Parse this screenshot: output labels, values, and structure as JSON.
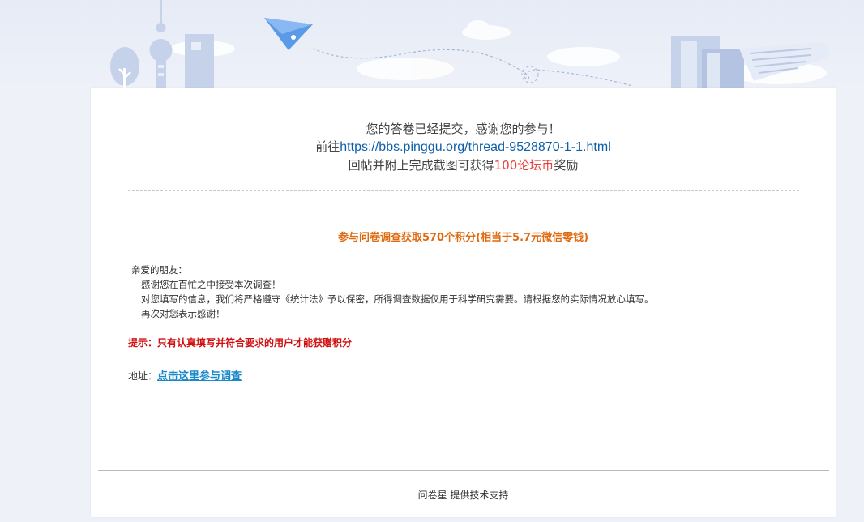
{
  "notice": {
    "line1": "您的答卷已经提交，感谢您的参与！",
    "line2_prefix": "前往",
    "line2_link": "https://bbs.pinggu.org/thread-9528870-1-1.html",
    "line3_prefix": "回帖并附上完成截图可获得",
    "line3_highlight": "100论坛币",
    "line3_suffix": "奖励"
  },
  "survey_title": "参与问卷调查获取570个积分(相当于5.7元微信零钱)",
  "letter": {
    "greeting": "亲爱的朋友：",
    "lines": [
      "感谢您在百忙之中接受本次调查！",
      "对您填写的信息，我们将严格遵守《统计法》予以保密，所得调查数据仅用于科学研究需要。请根据您的实际情况放心填写。",
      "再次对您表示感谢！"
    ]
  },
  "tip": "提示：只有认真填写并符合要求的用户才能获赠积分",
  "address": {
    "label": "地址：",
    "link_text": "点击这里参与调查"
  },
  "footer": {
    "brand": "问卷星",
    "text": " 提供技术支持"
  },
  "colors": {
    "link": "#0f5fa8",
    "highlight": "#e8403c",
    "title_orange": "#e06a10",
    "tip_red": "#d01010",
    "survey_link": "#1a89c9"
  }
}
